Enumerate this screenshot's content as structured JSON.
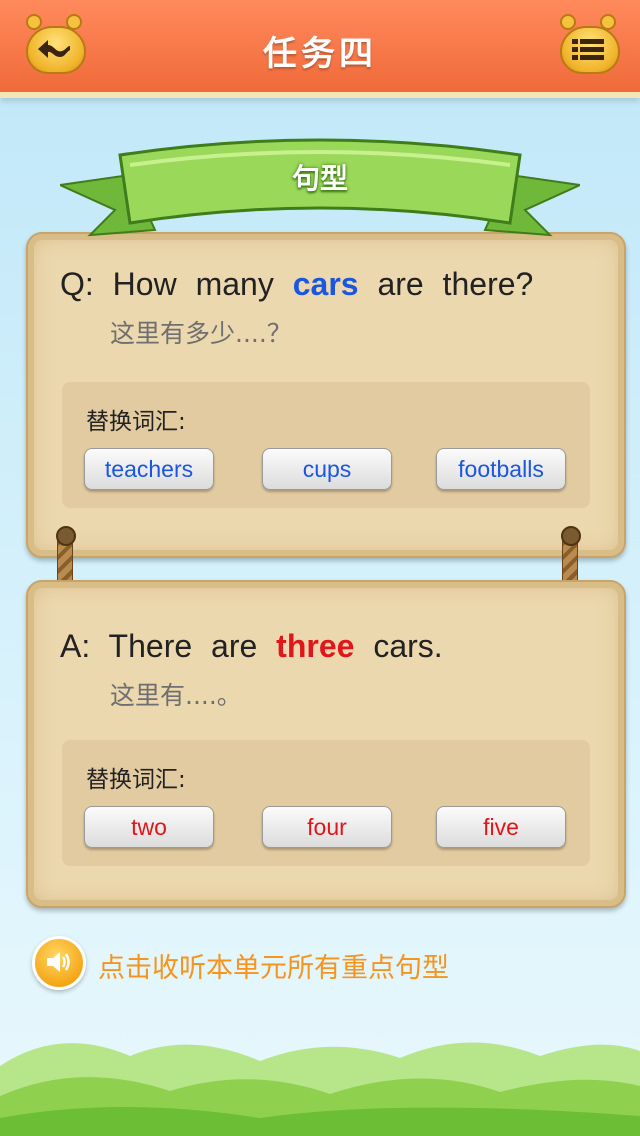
{
  "header": {
    "title": "任务四",
    "back_icon": "back-arrow-icon",
    "menu_icon": "menu-list-icon"
  },
  "ribbon": {
    "title": "句型"
  },
  "question": {
    "prefix": "Q:",
    "words_before": "How many",
    "highlight": "cars",
    "words_after": "are there?",
    "translation": "这里有多少....？",
    "panel_label": "替换词汇:",
    "options": [
      "teachers",
      "cups",
      "footballs"
    ]
  },
  "answer": {
    "prefix": "A:",
    "words_before": "There are",
    "highlight": "three",
    "words_after": "cars.",
    "translation": "这里有....。",
    "panel_label": "替换词汇:",
    "options": [
      "two",
      "four",
      "five"
    ]
  },
  "audio": {
    "icon": "speaker-icon",
    "label": "点击收听本单元所有重点句型"
  },
  "colors": {
    "header": "#f06a3a",
    "highlight_blue": "#1a56e0",
    "highlight_red": "#e0161a",
    "audio_text": "#f7941d",
    "ribbon_green": "#8fd14f"
  }
}
